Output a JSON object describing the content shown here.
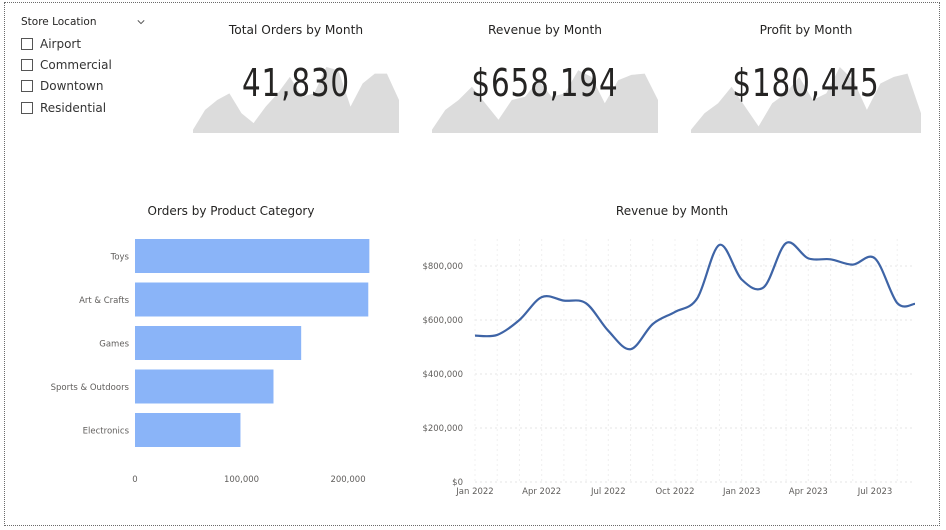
{
  "slicer": {
    "title": "Store Location",
    "items": [
      {
        "label": "Airport",
        "checked": false
      },
      {
        "label": "Commercial",
        "checked": false
      },
      {
        "label": "Downtown",
        "checked": false
      },
      {
        "label": "Residential",
        "checked": false
      }
    ]
  },
  "kpis": [
    {
      "title": "Total Orders by Month",
      "value": "41,830"
    },
    {
      "title": "Revenue by Month",
      "value": "$658,194"
    },
    {
      "title": "Profit by Month",
      "value": "$180,445"
    }
  ],
  "colors": {
    "bar": "#8AB4F8",
    "line": "#3E64A6",
    "spark": "#DCDCDC",
    "grid": "#E6E6E6",
    "text": "#252423",
    "axis_text": "#605E5C"
  },
  "chart_data": [
    {
      "type": "bar",
      "orientation": "horizontal",
      "title": "Orders by Product Category",
      "categories": [
        "Toys",
        "Art & Crafts",
        "Games",
        "Sports & Outdoors",
        "Electronics"
      ],
      "values": [
        220000,
        219000,
        156000,
        130000,
        99000
      ],
      "xlim": [
        0,
        230000
      ],
      "xticks": [
        0,
        100000,
        200000
      ],
      "xtick_labels": [
        "0",
        "100,000",
        "200,000"
      ],
      "grid": false,
      "xlabel": "",
      "ylabel": ""
    },
    {
      "type": "line",
      "title": "Revenue by Month",
      "x": [
        "2022-01",
        "2022-02",
        "2022-03",
        "2022-04",
        "2022-05",
        "2022-06",
        "2022-07",
        "2022-08",
        "2022-09",
        "2022-10",
        "2022-11",
        "2022-12",
        "2023-01",
        "2023-02",
        "2023-03",
        "2023-04",
        "2023-05",
        "2023-06",
        "2023-07",
        "2023-08"
      ],
      "values": [
        542000,
        545000,
        600000,
        685000,
        672000,
        662000,
        560000,
        492000,
        585000,
        630000,
        680000,
        878000,
        750000,
        722000,
        885000,
        828000,
        825000,
        805000,
        828000,
        663000
      ],
      "last_value": 660000,
      "ylim": [
        0,
        900000
      ],
      "yticks": [
        0,
        200000,
        400000,
        600000,
        800000
      ],
      "ytick_labels": [
        "$0",
        "$200,000",
        "$400,000",
        "$600,000",
        "$800,000"
      ],
      "xtick_labels": [
        "Jan 2022",
        "Apr 2022",
        "Jul 2022",
        "Oct 2022",
        "Jan 2023",
        "Apr 2023",
        "Jul 2023"
      ],
      "grid": true,
      "xlabel": "",
      "ylabel": ""
    }
  ],
  "sparklines": [
    [
      0.05,
      0.35,
      0.5,
      0.6,
      0.3,
      0.15,
      0.4,
      0.6,
      0.85,
      0.55,
      0.6,
      1.0,
      0.95,
      0.4,
      0.75,
      0.9,
      0.9,
      0.5
    ],
    [
      0.05,
      0.35,
      0.5,
      0.7,
      0.45,
      0.2,
      0.5,
      0.55,
      0.8,
      0.55,
      0.6,
      0.95,
      0.85,
      0.45,
      0.8,
      0.88,
      0.9,
      0.5
    ],
    [
      0.05,
      0.3,
      0.45,
      0.7,
      0.4,
      0.1,
      0.45,
      0.6,
      0.85,
      0.5,
      0.6,
      1.0,
      0.8,
      0.35,
      0.75,
      0.85,
      0.9,
      0.3
    ]
  ]
}
